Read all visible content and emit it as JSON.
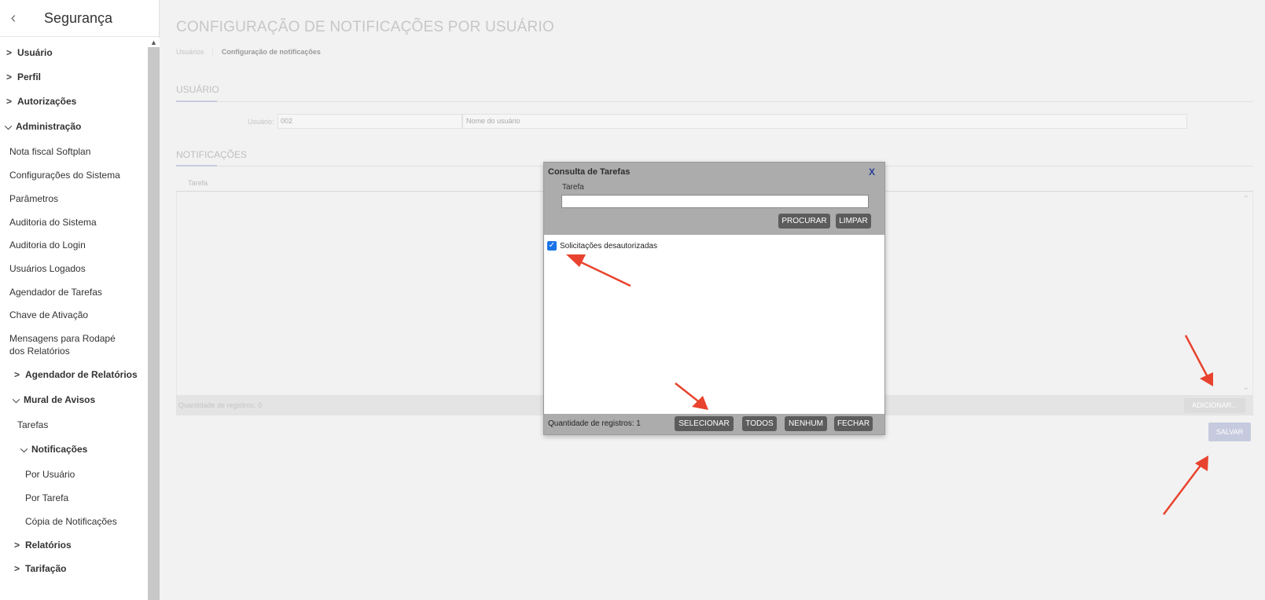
{
  "sidebar": {
    "title": "Segurança",
    "back_icon": "‹",
    "items": [
      {
        "label": "Usuário",
        "expanded": false,
        "bold": true
      },
      {
        "label": "Perfil",
        "expanded": false,
        "bold": true
      },
      {
        "label": "Autorizações",
        "expanded": false,
        "bold": true
      },
      {
        "label": "Administração",
        "expanded": true,
        "bold": true
      },
      {
        "label": "Nota fiscal Softplan"
      },
      {
        "label": "Configurações do Sistema"
      },
      {
        "label": "Parâmetros"
      },
      {
        "label": "Auditoria do Sistema"
      },
      {
        "label": "Auditoria do Login"
      },
      {
        "label": "Usuários Logados"
      },
      {
        "label": "Agendador de Tarefas"
      },
      {
        "label": "Chave de Ativação"
      },
      {
        "label": "Mensagens para Rodapé"
      },
      {
        "label": "dos Relatórios"
      },
      {
        "label": "Agendador de Relatórios",
        "expanded": false,
        "bold": true
      },
      {
        "label": "Mural de Avisos",
        "expanded": true,
        "bold": true
      },
      {
        "label": "Tarefas"
      },
      {
        "label": "Notificações",
        "expanded": true,
        "bold": true
      },
      {
        "label": "Por Usuário"
      },
      {
        "label": "Por Tarefa"
      },
      {
        "label": "Cópia de Notificações"
      },
      {
        "label": "Relatórios",
        "expanded": false,
        "bold": true
      },
      {
        "label": "Tarifação",
        "expanded": false,
        "bold": true
      }
    ]
  },
  "main": {
    "title": "CONFIGURAÇÃO DE NOTIFICAÇÕES POR USUÁRIO",
    "breadcrumb": [
      "Usuários",
      "Configuração de notificações"
    ],
    "user_section": {
      "title": "USUÁRIO",
      "field_label": "Usuário:",
      "code_value": "002",
      "name_value": "Nome do usuário"
    },
    "notifications_section": {
      "title": "NOTIFICAÇÕES",
      "column_header": "Tarefa",
      "record_count": "Quantidade de registros: 0",
      "add_button": "ADICIONAR...",
      "save_button": "SALVAR"
    }
  },
  "modal": {
    "title": "Consulta de Tarefas",
    "close_label": "X",
    "field_label": "Tarefa",
    "search_value": "",
    "search_button": "PROCURAR",
    "clear_button": "LIMPAR",
    "items": [
      {
        "label": "Solicitações desautorizadas",
        "checked": true
      }
    ],
    "record_count": "Quantidade de registros: 1",
    "select_button": "SELECIONAR",
    "all_button": "TODOS",
    "none_button": "NENHUM",
    "close_button": "FECHAR"
  },
  "colors": {
    "annotation_arrow": "#e8432e",
    "checkbox": "#1a73e8",
    "modal_header": "#acacac",
    "modal_button": "#5c5c5c"
  }
}
